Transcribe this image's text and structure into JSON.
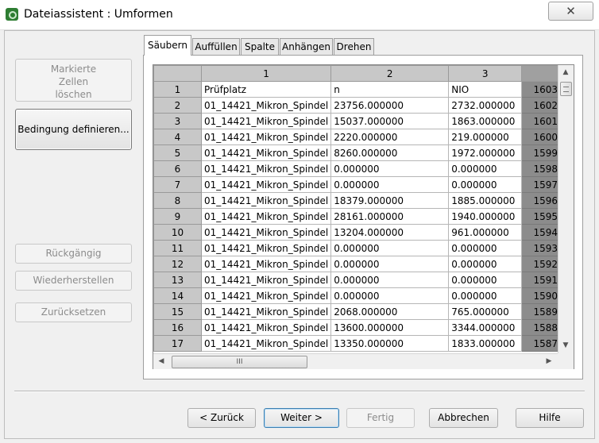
{
  "window": {
    "title": "Dateiassistent : Umformen",
    "close_label": "✕"
  },
  "left_buttons": {
    "markierte_lines": [
      "Markierte",
      "Zellen",
      "löschen"
    ],
    "bedingung": "Bedingung definieren...",
    "rueckgaengig": "Rückgängig",
    "wiederherstellen": "Wiederherstellen",
    "zuruecksetzen": "Zurücksetzen"
  },
  "tabs": [
    "Säubern",
    "Auffüllen",
    "Spalte",
    "Anhängen",
    "Drehen"
  ],
  "active_tab": "Säubern",
  "grid": {
    "column_headers": [
      "1",
      "2",
      "3",
      ""
    ],
    "rows": [
      [
        "1",
        "Prüfplatz",
        "n",
        "NIO",
        "1603"
      ],
      [
        "2",
        "01_14421_Mikron_Spindel",
        "23756.000000",
        "2732.000000",
        "1602"
      ],
      [
        "3",
        "01_14421_Mikron_Spindel",
        "15037.000000",
        "1863.000000",
        "1601"
      ],
      [
        "4",
        "01_14421_Mikron_Spindel",
        "2220.000000",
        "219.000000",
        "1600"
      ],
      [
        "5",
        "01_14421_Mikron_Spindel",
        "8260.000000",
        "1972.000000",
        "1599"
      ],
      [
        "6",
        "01_14421_Mikron_Spindel",
        "0.000000",
        "0.000000",
        "1598"
      ],
      [
        "7",
        "01_14421_Mikron_Spindel",
        "0.000000",
        "0.000000",
        "1597"
      ],
      [
        "8",
        "01_14421_Mikron_Spindel",
        "18379.000000",
        "1885.000000",
        "1596"
      ],
      [
        "9",
        "01_14421_Mikron_Spindel",
        "28161.000000",
        "1940.000000",
        "1595"
      ],
      [
        "10",
        "01_14421_Mikron_Spindel",
        "13204.000000",
        "961.000000",
        "1594"
      ],
      [
        "11",
        "01_14421_Mikron_Spindel",
        "0.000000",
        "0.000000",
        "1593"
      ],
      [
        "12",
        "01_14421_Mikron_Spindel",
        "0.000000",
        "0.000000",
        "1592"
      ],
      [
        "13",
        "01_14421_Mikron_Spindel",
        "0.000000",
        "0.000000",
        "1591"
      ],
      [
        "14",
        "01_14421_Mikron_Spindel",
        "0.000000",
        "0.000000",
        "1590"
      ],
      [
        "15",
        "01_14421_Mikron_Spindel",
        "2068.000000",
        "765.000000",
        "1589"
      ],
      [
        "16",
        "01_14421_Mikron_Spindel",
        "13600.000000",
        "3344.000000",
        "1588"
      ],
      [
        "17",
        "01_14421_Mikron_Spindel",
        "13350.000000",
        "1833.000000",
        "1587"
      ]
    ]
  },
  "scrollbar": {
    "grip_label": "III",
    "up": "▲",
    "down": "▼",
    "left": "◀",
    "right": "▶"
  },
  "footer": {
    "back": "< Zurück",
    "next": "Weiter >",
    "finish": "Fertig",
    "cancel": "Abbrechen",
    "help": "Hilfe"
  }
}
